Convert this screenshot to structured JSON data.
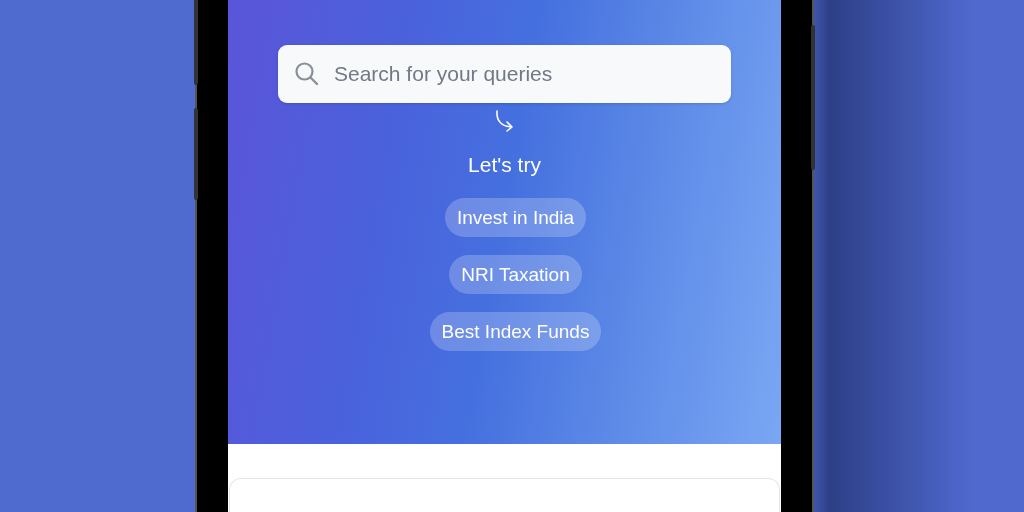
{
  "search": {
    "placeholder": "Search for your queries"
  },
  "prompt": "Let's try",
  "suggestions": [
    "Invest in India",
    "NRI Taxation",
    "Best Index Funds"
  ]
}
